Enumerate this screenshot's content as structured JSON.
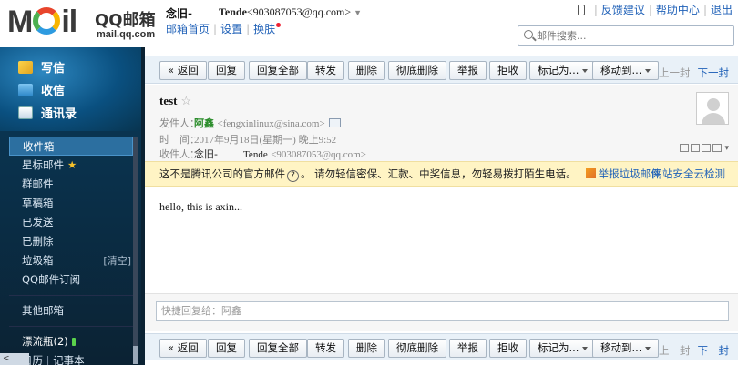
{
  "header": {
    "logo_text_left": "M",
    "logo_text_right": "il",
    "logo_title": "QQ邮箱",
    "logo_domain": "mail.qq.com",
    "nickname": "念旧-",
    "account_name": "Tende",
    "account_email": "<903087053@qq.com>",
    "links": [
      "邮箱首页",
      "设置",
      "换肤"
    ],
    "top_links": [
      "反馈建议",
      "帮助中心",
      "退出"
    ],
    "search_placeholder": "邮件搜索..."
  },
  "sidebar": {
    "primary": [
      {
        "label": "写信",
        "icon": "write-icon"
      },
      {
        "label": "收信",
        "icon": "inbox-icon"
      },
      {
        "label": "通讯录",
        "icon": "contacts-icon"
      }
    ],
    "folders": [
      {
        "label": "收件箱",
        "active": true
      },
      {
        "label": "星标邮件",
        "star": "★"
      },
      {
        "label": "群邮件"
      },
      {
        "label": "草稿箱"
      },
      {
        "label": "已发送"
      },
      {
        "label": "已删除"
      },
      {
        "label": "垃圾箱",
        "extra": "[清空]"
      },
      {
        "label": "QQ邮件订阅"
      }
    ],
    "other_folders": "其他邮箱",
    "drift_bottle": "漂流瓶(2)",
    "calendar": "日历",
    "notes": "记事本",
    "collapse": "<"
  },
  "toolbar": {
    "back": "« 返回",
    "reply": "回复",
    "reply_all": "回复全部",
    "forward": "转发",
    "delete": "删除",
    "delete_permanent": "彻底删除",
    "report": "举报",
    "reject": "拒收",
    "mark_as": "标记为...",
    "move_to": "移动到...",
    "prev": "上一封",
    "next": "下一封"
  },
  "mail": {
    "subject": "test",
    "from_label": "发件人：",
    "from_name": "阿鑫",
    "from_addr": "<fengxinlinux@sina.com>",
    "time_label": "时　间：",
    "time_value": "2017年9月18日(星期一) 晚上9:52",
    "to_label": "收件人：",
    "to_name": "念旧-",
    "to_account": "Tende",
    "to_addr": "<903087053@qq.com>",
    "warning_pre": "这不是腾讯公司的官方邮件",
    "warning_help": "?",
    "warning_post": "。 请勿轻信密保、汇款、中奖信息，勿轻易拨打陌生电话。",
    "report_spam": "举报垃圾邮件",
    "safety_check": "网站安全云检测",
    "body": "hello, this is axin...",
    "quick_reply_placeholder": "快捷回复给：阿鑫"
  }
}
